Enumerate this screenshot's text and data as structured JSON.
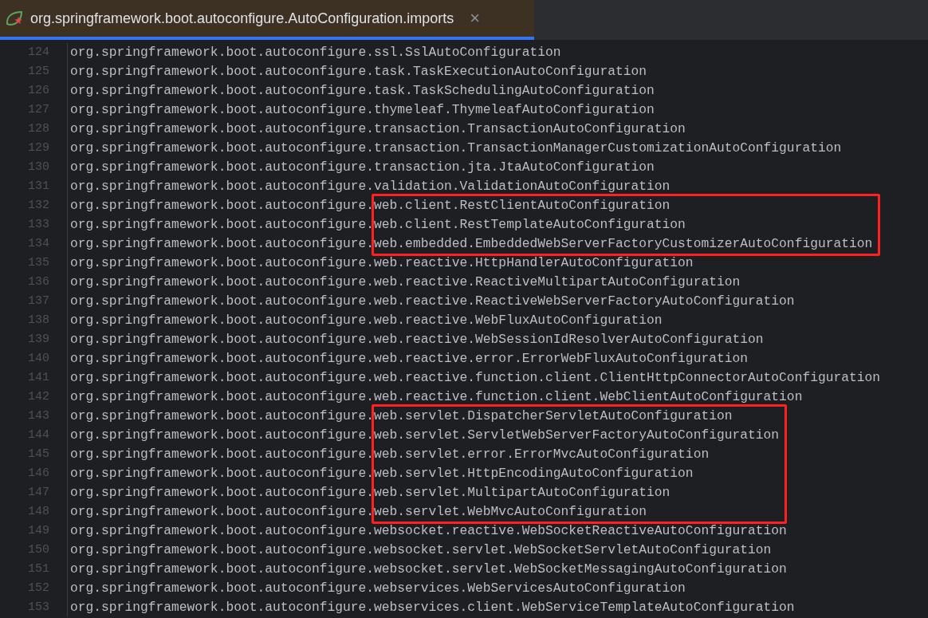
{
  "tab": {
    "title": "org.springframework.boot.autoconfigure.AutoConfiguration.imports",
    "close": "×",
    "selected": true
  },
  "blocks": [
    {
      "kind": "plain",
      "lines": [
        {
          "number": "124",
          "text": "org.springframework.boot.autoconfigure.ssl.SslAutoConfiguration"
        },
        {
          "number": "125",
          "text": "org.springframework.boot.autoconfigure.task.TaskExecutionAutoConfiguration"
        },
        {
          "number": "126",
          "text": "org.springframework.boot.autoconfigure.task.TaskSchedulingAutoConfiguration"
        },
        {
          "number": "127",
          "text": "org.springframework.boot.autoconfigure.thymeleaf.ThymeleafAutoConfiguration"
        },
        {
          "number": "128",
          "text": "org.springframework.boot.autoconfigure.transaction.TransactionAutoConfiguration"
        },
        {
          "number": "129",
          "text": "org.springframework.boot.autoconfigure.transaction.TransactionManagerCustomizationAutoConfiguration"
        },
        {
          "number": "130",
          "text": "org.springframework.boot.autoconfigure.transaction.jta.JtaAutoConfiguration"
        },
        {
          "number": "131",
          "text": "org.springframework.boot.autoconfigure.validation.ValidationAutoConfiguration"
        }
      ]
    },
    {
      "kind": "boxed",
      "lines": [
        {
          "number": "132",
          "text": "org.springframework.boot.autoconfigure.web.client.RestClientAutoConfiguration"
        },
        {
          "number": "133",
          "text": "org.springframework.boot.autoconfigure.web.client.RestTemplateAutoConfiguration"
        },
        {
          "number": "134",
          "text": "org.springframework.boot.autoconfigure.web.embedded.EmbeddedWebServerFactoryCustomizerAutoConfiguration"
        }
      ]
    },
    {
      "kind": "plain",
      "lines": [
        {
          "number": "135",
          "text": "org.springframework.boot.autoconfigure.web.reactive.HttpHandlerAutoConfiguration"
        },
        {
          "number": "136",
          "text": "org.springframework.boot.autoconfigure.web.reactive.ReactiveMultipartAutoConfiguration"
        },
        {
          "number": "137",
          "text": "org.springframework.boot.autoconfigure.web.reactive.ReactiveWebServerFactoryAutoConfiguration"
        },
        {
          "number": "138",
          "text": "org.springframework.boot.autoconfigure.web.reactive.WebFluxAutoConfiguration"
        },
        {
          "number": "139",
          "text": "org.springframework.boot.autoconfigure.web.reactive.WebSessionIdResolverAutoConfiguration"
        },
        {
          "number": "140",
          "text": "org.springframework.boot.autoconfigure.web.reactive.error.ErrorWebFluxAutoConfiguration"
        },
        {
          "number": "141",
          "text": "org.springframework.boot.autoconfigure.web.reactive.function.client.ClientHttpConnectorAutoConfiguration"
        },
        {
          "number": "142",
          "text": "org.springframework.boot.autoconfigure.web.reactive.function.client.WebClientAutoConfiguration"
        }
      ]
    },
    {
      "kind": "boxed",
      "lines": [
        {
          "number": "143",
          "text": "org.springframework.boot.autoconfigure.web.servlet.DispatcherServletAutoConfiguration"
        },
        {
          "number": "144",
          "text": "org.springframework.boot.autoconfigure.web.servlet.ServletWebServerFactoryAutoConfiguration"
        },
        {
          "number": "145",
          "text": "org.springframework.boot.autoconfigure.web.servlet.error.ErrorMvcAutoConfiguration"
        },
        {
          "number": "146",
          "text": "org.springframework.boot.autoconfigure.web.servlet.HttpEncodingAutoConfiguration"
        },
        {
          "number": "147",
          "text": "org.springframework.boot.autoconfigure.web.servlet.MultipartAutoConfiguration"
        },
        {
          "number": "148",
          "text": "org.springframework.boot.autoconfigure.web.servlet.WebMvcAutoConfiguration"
        }
      ]
    },
    {
      "kind": "plain",
      "lines": [
        {
          "number": "149",
          "text": "org.springframework.boot.autoconfigure.websocket.reactive.WebSocketReactiveAutoConfiguration"
        },
        {
          "number": "150",
          "text": "org.springframework.boot.autoconfigure.websocket.servlet.WebSocketServletAutoConfiguration"
        },
        {
          "number": "151",
          "text": "org.springframework.boot.autoconfigure.websocket.servlet.WebSocketMessagingAutoConfiguration"
        },
        {
          "number": "152",
          "text": "org.springframework.boot.autoconfigure.webservices.WebServicesAutoConfiguration"
        },
        {
          "number": "153",
          "text": "org.springframework.boot.autoconfigure.webservices.client.WebServiceTemplateAutoConfiguration"
        }
      ]
    }
  ]
}
